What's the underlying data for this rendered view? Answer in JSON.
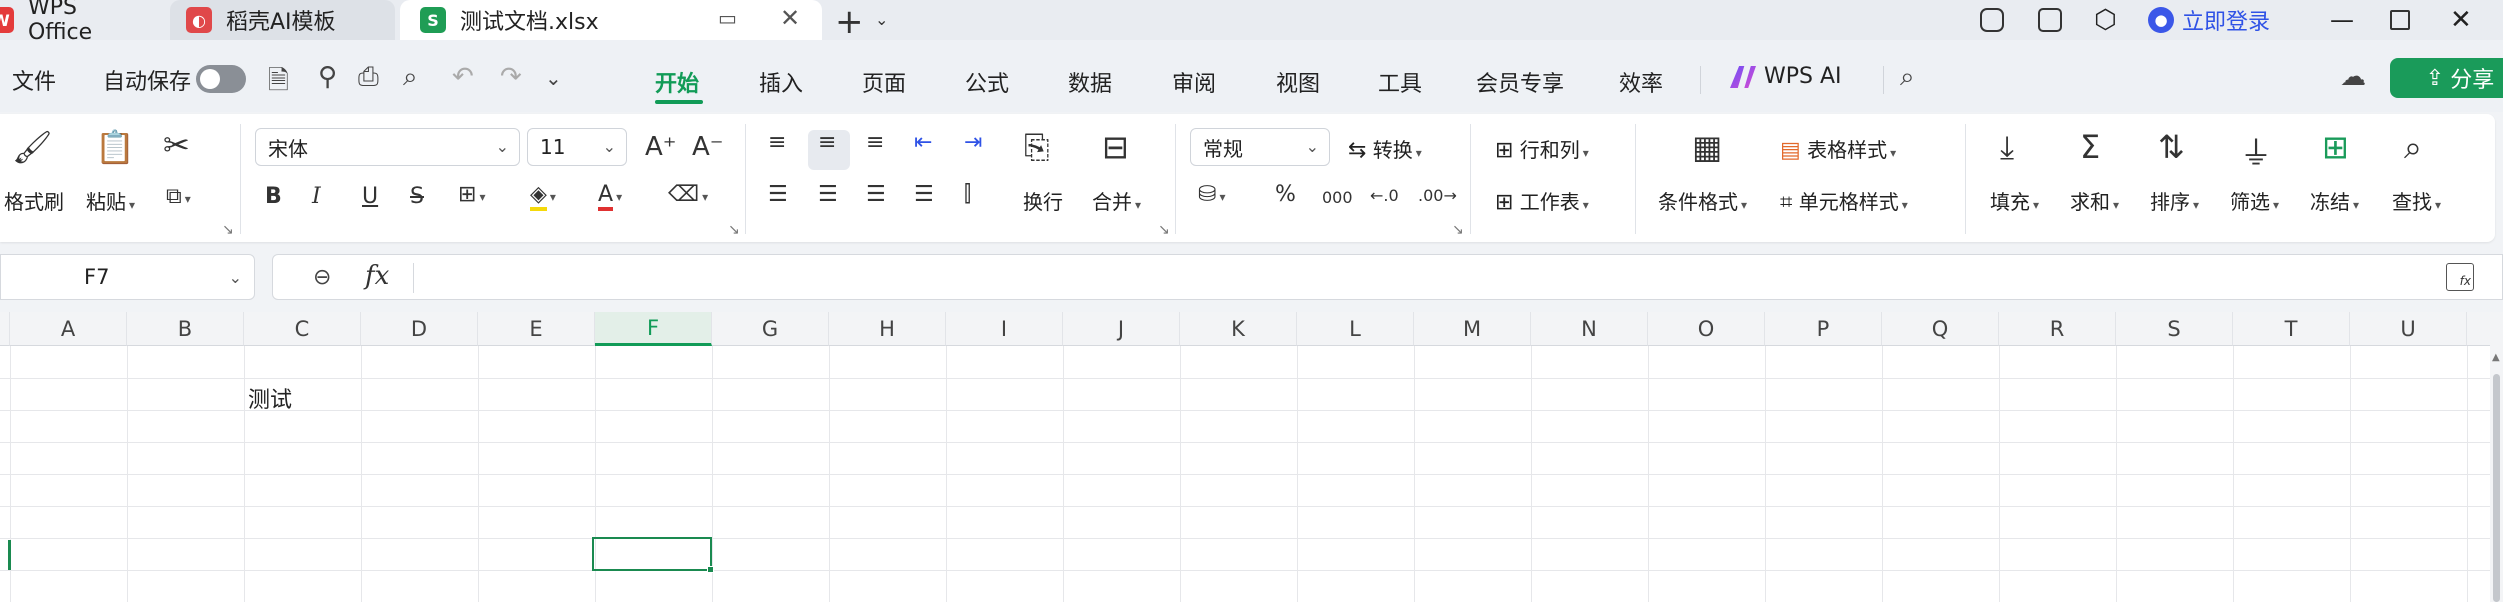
{
  "tabs": {
    "wps": "WPS Office",
    "daoke": "稻壳AI模板",
    "doc": "测试文档.xlsx"
  },
  "titlebar": {
    "login": "立即登录"
  },
  "menu": {
    "file": "文件",
    "autosave": "自动保存",
    "items": [
      "开始",
      "插入",
      "页面",
      "公式",
      "数据",
      "审阅",
      "视图",
      "工具",
      "会员专享",
      "效率"
    ],
    "wps_ai": "WPS AI",
    "share": "分享"
  },
  "ribbon": {
    "format_painter": "格式刷",
    "paste": "粘贴",
    "font_name": "宋体",
    "font_size": "11",
    "wrap": "换行",
    "merge": "合并",
    "number_format": "常规",
    "convert": "转换",
    "rows_cols": "行和列",
    "worksheet": "工作表",
    "cond_format": "条件格式",
    "table_style": "表格样式",
    "cell_style": "单元格样式",
    "fill": "填充",
    "sum": "求和",
    "sort": "排序",
    "filter": "筛选",
    "freeze": "冻结",
    "find": "查找"
  },
  "formula_bar": {
    "name_box": "F7",
    "fx": "fx",
    "value": ""
  },
  "sheet": {
    "columns": [
      "A",
      "B",
      "C",
      "D",
      "E",
      "F",
      "G",
      "H",
      "I",
      "J",
      "K",
      "L",
      "M",
      "N",
      "O",
      "P",
      "Q",
      "R",
      "S",
      "T",
      "U"
    ],
    "selected_column": "F",
    "active_cell": "F7",
    "c2_text": "测试"
  },
  "colors": {
    "accent": "#119b57",
    "share_bg": "#1a9b5a",
    "login": "#2f52e6"
  }
}
